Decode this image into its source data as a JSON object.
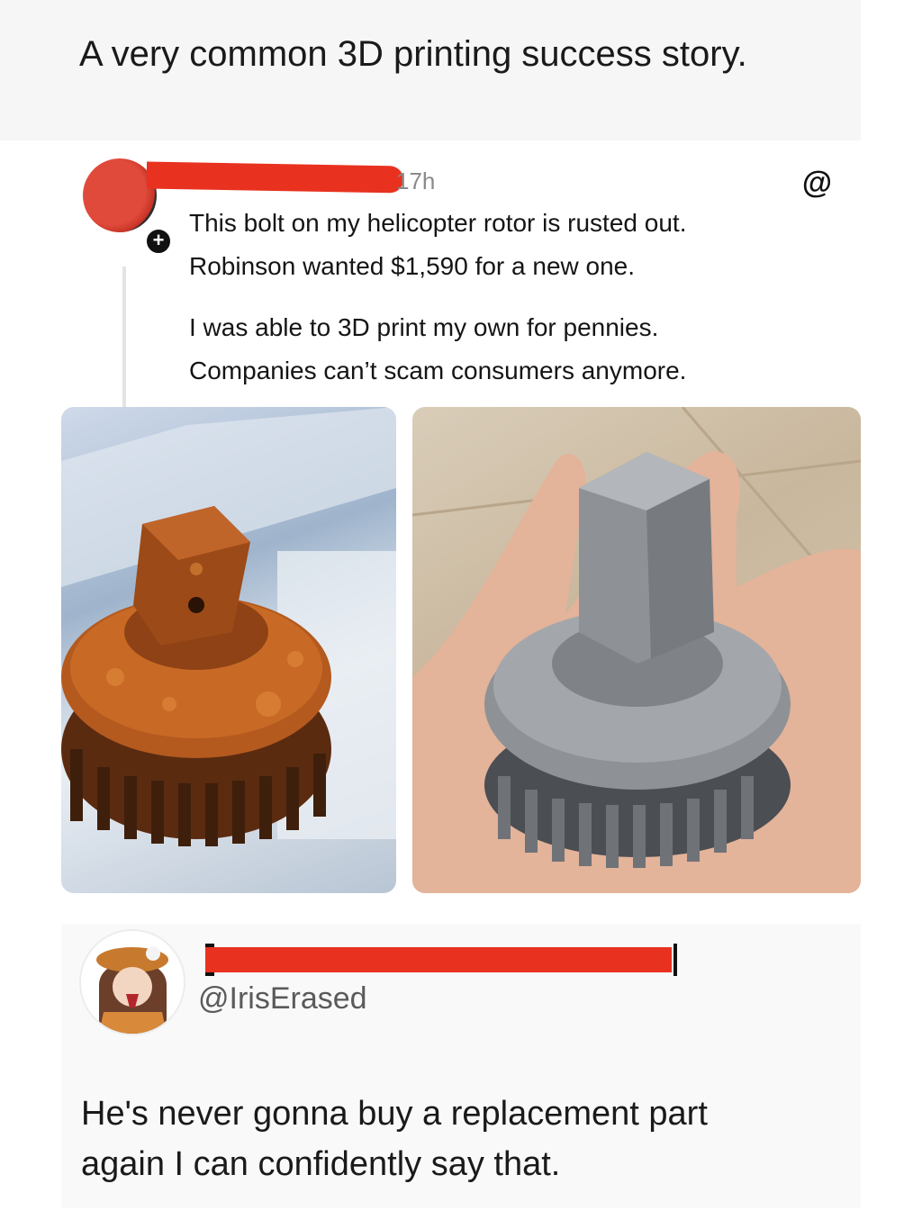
{
  "caption": "A very common 3D printing success story.",
  "threads_post": {
    "timestamp": "17h",
    "app_icon": "threads-icon",
    "lines": [
      "This bolt on my helicopter rotor is rusted out.",
      "Robinson wanted $1,590 for a new one.",
      "I was able to 3D print my own for pennies.",
      "Companies can’t scam consumers anymore."
    ],
    "photos": [
      "rusted-gear-photo",
      "printed-gear-photo"
    ]
  },
  "reply": {
    "handle": "@IrisErased",
    "text_lines": [
      "He's never gonna buy a replacement part",
      "again I can confidently say that."
    ]
  },
  "colors": {
    "redaction": "#e8321f",
    "rust": "#9c4a18",
    "print_gray": "#8e9297"
  }
}
